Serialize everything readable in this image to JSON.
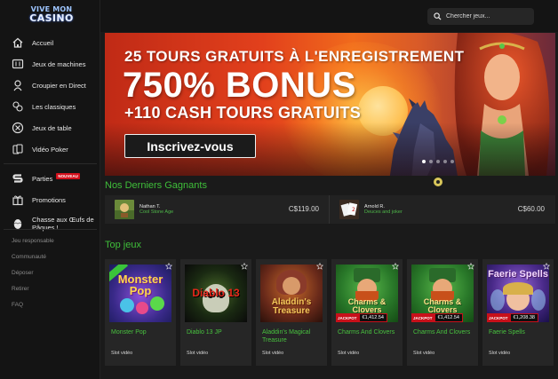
{
  "logo": {
    "line1": "VIVE MON",
    "line2": "CASINO"
  },
  "sidebar": {
    "items": [
      {
        "label": "Accueil",
        "icon": "home-icon"
      },
      {
        "label": "Jeux de machines",
        "icon": "slot-machine-icon"
      },
      {
        "label": "Croupier en Direct",
        "icon": "dealer-icon"
      },
      {
        "label": "Les classiques",
        "icon": "chips-icon"
      },
      {
        "label": "Jeux de table",
        "icon": "table-chip-icon"
      },
      {
        "label": "Vidéo Poker",
        "icon": "cards-icon"
      }
    ],
    "items2": [
      {
        "label": "Parties",
        "icon": "s-logo-icon",
        "badge": "NOUVEAU"
      },
      {
        "label": "Promotions",
        "icon": "gift-icon"
      },
      {
        "label": "Chasse aux Œufs de Pâques !",
        "icon": "egg-icon"
      }
    ],
    "links": [
      "Jeu responsable",
      "Communauté",
      "Déposer",
      "Retirer",
      "FAQ"
    ]
  },
  "search": {
    "placeholder": "Chercher jeux..."
  },
  "hero": {
    "line1": "25 TOURS GRATUITS À L'ENREGISTREMENT",
    "line2": "750% BONUS",
    "line3": "+110 CASH TOURS GRATUITS",
    "cta": "Inscrivez-vous",
    "slides": 5,
    "active_slide": 1
  },
  "winners": {
    "title": "Nos Derniers Gagnants",
    "list": [
      {
        "name": "Nathan T.",
        "game": "Cool Stone Age",
        "amount": "C$119.00"
      },
      {
        "name": "Arnold R.",
        "game": "Deuces and joker",
        "amount": "C$60.00"
      }
    ]
  },
  "top_games": {
    "title": "Top jeux",
    "list": [
      {
        "title": "Monster Pop",
        "type": "Slot vidéo",
        "art_text": "Monster Pop",
        "jackpot": null
      },
      {
        "title": "Diablo 13 JP",
        "type": "Slot vidéo",
        "art_text": "Diablo 13",
        "jackpot": null
      },
      {
        "title": "Aladdin's Magical Treasure",
        "type": "Slot vidéo",
        "art_text": "Aladdin's Treasure",
        "jackpot": null
      },
      {
        "title": "Charms And Clovers",
        "type": "Slot vidéo",
        "art_text": "Charms & Clovers",
        "jackpot": {
          "label": "JACKPOT",
          "value": "€1,412.54"
        }
      },
      {
        "title": "Charms And Clovers",
        "type": "Slot vidéo",
        "art_text": "Charms & Clovers",
        "jackpot": {
          "label": "JACKPOT",
          "value": "€1,412.54"
        }
      },
      {
        "title": "Faerie Spells",
        "type": "Slot vidéo",
        "art_text": "Faerie Spells",
        "jackpot": {
          "label": "JACKPOT",
          "value": "€1,208.38"
        }
      }
    ]
  },
  "colors": {
    "accent_green": "#3fbf3a",
    "jackpot_red": "#c8101a",
    "badge_red": "#d3101c"
  }
}
